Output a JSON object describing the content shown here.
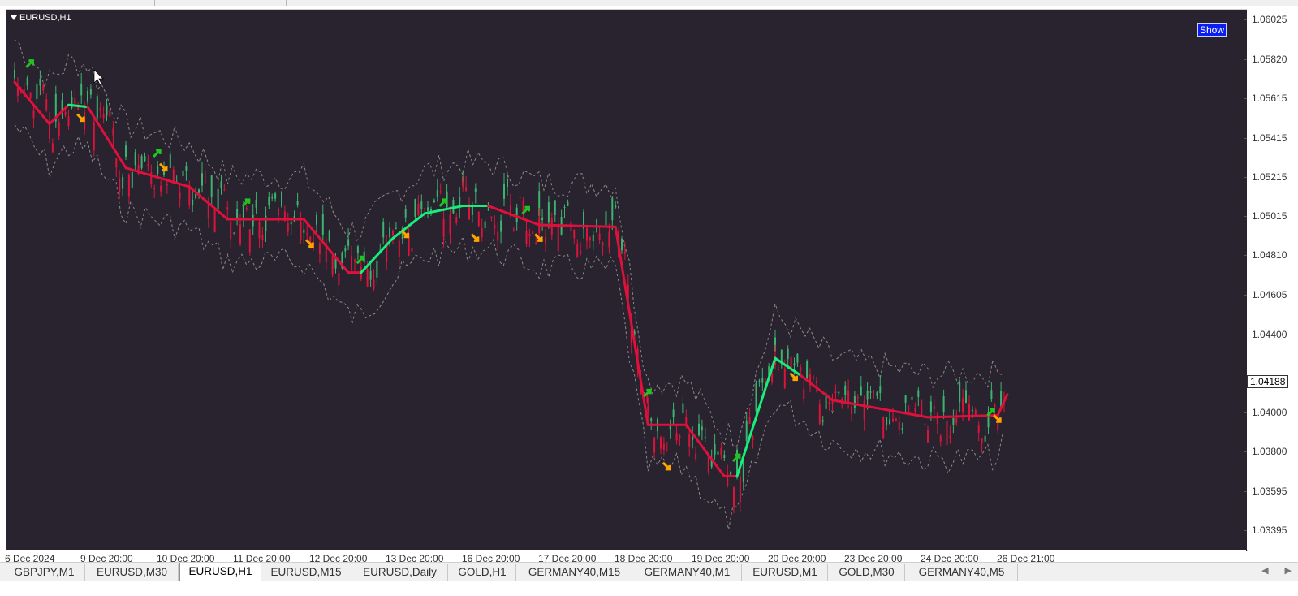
{
  "window": {
    "symbol_label": "EURUSD,H1",
    "show_button": "Show"
  },
  "price_axis": {
    "ticks": [
      "1.06025",
      "1.05820",
      "1.05615",
      "1.05415",
      "1.05215",
      "1.05015",
      "1.04810",
      "1.04605",
      "1.04400",
      "1.04188",
      "1.04000",
      "1.03800",
      "1.03595",
      "1.03395"
    ],
    "current_price": "1.04188"
  },
  "time_axis": {
    "ticks": [
      "6 Dec 2024",
      "9 Dec 20:00",
      "10 Dec 20:00",
      "11 Dec 20:00",
      "12 Dec 20:00",
      "13 Dec 20:00",
      "16 Dec 20:00",
      "17 Dec 20:00",
      "18 Dec 20:00",
      "19 Dec 20:00",
      "20 Dec 20:00",
      "23 Dec 20:00",
      "24 Dec 20:00",
      "26 Dec 21:00"
    ]
  },
  "tabs": [
    {
      "label": "GBPJPY,M1",
      "active": false
    },
    {
      "label": "EURUSD,M30",
      "active": false
    },
    {
      "label": "EURUSD,H1",
      "active": true
    },
    {
      "label": "EURUSD,M15",
      "active": false
    },
    {
      "label": "EURUSD,Daily",
      "active": false
    },
    {
      "label": "GOLD,H1",
      "active": false
    },
    {
      "label": "GERMANY40,M15",
      "active": false
    },
    {
      "label": "GERMANY40,M1",
      "active": false
    },
    {
      "label": "EURUSD,M1",
      "active": false
    },
    {
      "label": "GOLD,M30",
      "active": false
    },
    {
      "label": "GERMANY40,M5",
      "active": false
    }
  ],
  "colors": {
    "background": "#28232e",
    "bull_candle": "#3cb371",
    "bear_candle": "#dc143c",
    "trend_up": "#16f07a",
    "trend_down": "#e0103c",
    "buy_arrow": "#22c422",
    "sell_arrow": "#ffa500",
    "envelope": "#8a8a8a"
  },
  "icons": {
    "symbol_menu": "triangle-down-icon",
    "scroll_left": "triangle-left-icon",
    "scroll_right": "triangle-right-icon"
  },
  "chart_data": {
    "type": "candlestick",
    "symbol": "EURUSD",
    "timeframe": "H1",
    "ylim": [
      1.0329,
      1.0613
    ],
    "trend_line": {
      "points": [
        {
          "t": "06 Dec",
          "v": 1.0575,
          "state": "down"
        },
        {
          "t": "09 Dec 08:00",
          "v": 1.0553,
          "state": "down"
        },
        {
          "t": "09 Dec 14:00",
          "v": 1.0563,
          "state": "up"
        },
        {
          "t": "09 Dec 20:00",
          "v": 1.0562,
          "state": "down"
        },
        {
          "t": "10 Dec 08:00",
          "v": 1.053,
          "state": "down"
        },
        {
          "t": "11 Dec 04:00",
          "v": 1.052,
          "state": "down"
        },
        {
          "t": "11 Dec 16:00",
          "v": 1.0503,
          "state": "down"
        },
        {
          "t": "12 Dec 16:00",
          "v": 1.0503,
          "state": "down"
        },
        {
          "t": "13 Dec 06:00",
          "v": 1.0475,
          "state": "down"
        },
        {
          "t": "13 Dec 10:00",
          "v": 1.0475,
          "state": "up"
        },
        {
          "t": "13 Dec 20:00",
          "v": 1.0493,
          "state": "up"
        },
        {
          "t": "16 Dec 06:00",
          "v": 1.0506,
          "state": "up"
        },
        {
          "t": "16 Dec 18:00",
          "v": 1.051,
          "state": "up"
        },
        {
          "t": "17 Dec 02:00",
          "v": 1.051,
          "state": "down"
        },
        {
          "t": "17 Dec 18:00",
          "v": 1.05,
          "state": "down"
        },
        {
          "t": "18 Dec 18:00",
          "v": 1.0499,
          "state": "down"
        },
        {
          "t": "19 Dec 04:00",
          "v": 1.0395,
          "state": "down"
        },
        {
          "t": "19 Dec 16:00",
          "v": 1.0395,
          "state": "down"
        },
        {
          "t": "20 Dec 04:00",
          "v": 1.0368,
          "state": "down"
        },
        {
          "t": "20 Dec 08:00",
          "v": 1.0368,
          "state": "up"
        },
        {
          "t": "20 Dec 20:00",
          "v": 1.043,
          "state": "up"
        },
        {
          "t": "23 Dec 04:00",
          "v": 1.0421,
          "state": "down"
        },
        {
          "t": "23 Dec 14:00",
          "v": 1.0408,
          "state": "down"
        },
        {
          "t": "24 Dec 20:00",
          "v": 1.0399,
          "state": "down"
        },
        {
          "t": "26 Dec 18:00",
          "v": 1.04,
          "state": "down"
        },
        {
          "t": "26 Dec 21:00",
          "v": 1.0411,
          "state": "up"
        }
      ]
    },
    "signals": [
      {
        "t": "09 Dec 02:00",
        "type": "buy",
        "v": 1.0585
      },
      {
        "t": "09 Dec 18:00",
        "type": "sell",
        "v": 1.0556
      },
      {
        "t": "10 Dec 18:00",
        "type": "buy",
        "v": 1.0538
      },
      {
        "t": "10 Dec 20:00",
        "type": "sell",
        "v": 1.053
      },
      {
        "t": "11 Dec 22:00",
        "type": "buy",
        "v": 1.0512
      },
      {
        "t": "12 Dec 18:00",
        "type": "sell",
        "v": 1.049
      },
      {
        "t": "13 Dec 10:00",
        "type": "buy",
        "v": 1.0482
      },
      {
        "t": "16 Dec 00:00",
        "type": "sell",
        "v": 1.0495
      },
      {
        "t": "16 Dec 12:00",
        "type": "buy",
        "v": 1.0512
      },
      {
        "t": "16 Dec 22:00",
        "type": "sell",
        "v": 1.0493
      },
      {
        "t": "17 Dec 14:00",
        "type": "buy",
        "v": 1.0508
      },
      {
        "t": "17 Dec 18:00",
        "type": "sell",
        "v": 1.0493
      },
      {
        "t": "19 Dec 04:00",
        "type": "buy",
        "v": 1.0412
      },
      {
        "t": "19 Dec 10:00",
        "type": "sell",
        "v": 1.0373
      },
      {
        "t": "20 Dec 08:00",
        "type": "buy",
        "v": 1.0378
      },
      {
        "t": "23 Dec 02:00",
        "type": "sell",
        "v": 1.042
      },
      {
        "t": "26 Dec 16:00",
        "type": "buy",
        "v": 1.0402
      },
      {
        "t": "26 Dec 18:00",
        "type": "sell",
        "v": 1.0398
      }
    ]
  }
}
